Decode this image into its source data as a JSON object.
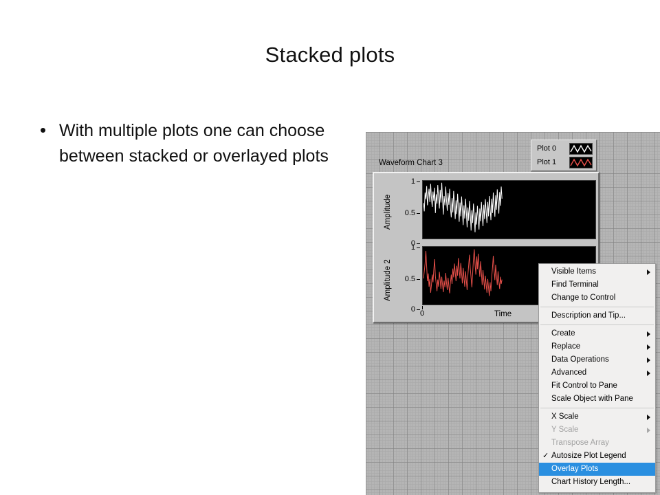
{
  "slide": {
    "title": "Stacked plots",
    "bullet_marker": "•",
    "bullet_text": "With multiple plots one can choose between stacked or overlayed plots"
  },
  "labview": {
    "chart_title": "Waveform Chart 3",
    "legend": {
      "rows": [
        {
          "label": "Plot 0",
          "color": "#ffffff",
          "icon": "waveform-icon"
        },
        {
          "label": "Plot 1",
          "color": "#e8504a",
          "icon": "waveform-icon"
        }
      ]
    },
    "axes": {
      "x_label": "Time",
      "x_tick_zero": "0",
      "top_y_label": "Amplitude",
      "bottom_y_label": "Amplitude 2",
      "y_ticks": [
        "1",
        "0.5",
        "0"
      ]
    },
    "colors": {
      "panel_grid": "#b5b5b5",
      "plot_background": "#000000",
      "plot0": "#ffffff",
      "plot1": "#e8504a",
      "menu_highlight": "#2a8fe0"
    }
  },
  "context_menu": {
    "items": [
      {
        "label": "Visible Items",
        "submenu": true,
        "disabled": false,
        "checked": false,
        "selected": false,
        "sep_after": false
      },
      {
        "label": "Find Terminal",
        "submenu": false,
        "disabled": false,
        "checked": false,
        "selected": false,
        "sep_after": false
      },
      {
        "label": "Change to Control",
        "submenu": false,
        "disabled": false,
        "checked": false,
        "selected": false,
        "sep_after": true
      },
      {
        "label": "Description and Tip...",
        "submenu": false,
        "disabled": false,
        "checked": false,
        "selected": false,
        "sep_after": true
      },
      {
        "label": "Create",
        "submenu": true,
        "disabled": false,
        "checked": false,
        "selected": false,
        "sep_after": false
      },
      {
        "label": "Replace",
        "submenu": true,
        "disabled": false,
        "checked": false,
        "selected": false,
        "sep_after": false
      },
      {
        "label": "Data Operations",
        "submenu": true,
        "disabled": false,
        "checked": false,
        "selected": false,
        "sep_after": false
      },
      {
        "label": "Advanced",
        "submenu": true,
        "disabled": false,
        "checked": false,
        "selected": false,
        "sep_after": false
      },
      {
        "label": "Fit Control to Pane",
        "submenu": false,
        "disabled": false,
        "checked": false,
        "selected": false,
        "sep_after": false
      },
      {
        "label": "Scale Object with Pane",
        "submenu": false,
        "disabled": false,
        "checked": false,
        "selected": false,
        "sep_after": true
      },
      {
        "label": "X Scale",
        "submenu": true,
        "disabled": false,
        "checked": false,
        "selected": false,
        "sep_after": false
      },
      {
        "label": "Y Scale",
        "submenu": true,
        "disabled": true,
        "checked": false,
        "selected": false,
        "sep_after": false
      },
      {
        "label": "Transpose Array",
        "submenu": false,
        "disabled": true,
        "checked": false,
        "selected": false,
        "sep_after": false
      },
      {
        "label": "Autosize Plot Legend",
        "submenu": false,
        "disabled": false,
        "checked": true,
        "selected": false,
        "sep_after": false
      },
      {
        "label": "Overlay Plots",
        "submenu": false,
        "disabled": false,
        "checked": false,
        "selected": true,
        "sep_after": false
      },
      {
        "label": "Chart History Length...",
        "submenu": false,
        "disabled": false,
        "checked": false,
        "selected": false,
        "sep_after": false
      }
    ],
    "checkmark_glyph": "✓"
  },
  "chart_data": {
    "type": "line",
    "title": "Waveform Chart 3",
    "xlabel": "Time",
    "layout": "stacked",
    "grid": false,
    "legend_position": "top-right",
    "panels": [
      {
        "name": "Plot 0",
        "ylabel": "Amplitude",
        "ylim": [
          0,
          1
        ],
        "yticks": [
          0,
          0.5,
          1
        ],
        "color": "#ffffff",
        "values": [
          0.62,
          0.47,
          0.81,
          0.69,
          0.93,
          0.58,
          0.74,
          0.88,
          0.64,
          0.97,
          0.71,
          0.55,
          0.83,
          0.66,
          0.9,
          0.44,
          0.78,
          0.61,
          0.95,
          0.72,
          0.52,
          0.86,
          0.63,
          0.99,
          0.7,
          0.41,
          0.75,
          0.58,
          0.92,
          0.67,
          0.48,
          0.8,
          0.59,
          0.88,
          0.53,
          0.36,
          0.71,
          0.45,
          0.84,
          0.6,
          0.33,
          0.67,
          0.42,
          0.79,
          0.55,
          0.28,
          0.63,
          0.38,
          0.74,
          0.5,
          0.22,
          0.58,
          0.34,
          0.7,
          0.46,
          0.18,
          0.54,
          0.3,
          0.66,
          0.43,
          0.12,
          0.49,
          0.26,
          0.61,
          0.39,
          0.09,
          0.45,
          0.23,
          0.57,
          0.35,
          0.14,
          0.52,
          0.29,
          0.64,
          0.41,
          0.2,
          0.59,
          0.33,
          0.69,
          0.47,
          0.26,
          0.64,
          0.38,
          0.75,
          0.52,
          0.31,
          0.7,
          0.44,
          0.81,
          0.58,
          0.37,
          0.76,
          0.5,
          0.87,
          0.64,
          0.43,
          0.82,
          0.57,
          0.92,
          0.7
        ]
      },
      {
        "name": "Plot 1",
        "ylabel": "Amplitude 2",
        "ylim": [
          0,
          1
        ],
        "yticks": [
          0,
          0.5,
          1
        ],
        "color": "#e8504a",
        "values": [
          0.45,
          0.58,
          0.72,
          0.95,
          0.66,
          0.4,
          0.54,
          0.3,
          0.44,
          0.19,
          0.33,
          0.52,
          0.38,
          0.61,
          0.8,
          0.49,
          0.35,
          0.22,
          0.43,
          0.3,
          0.57,
          0.42,
          0.26,
          0.48,
          0.33,
          0.2,
          0.41,
          0.29,
          0.55,
          0.37,
          0.24,
          0.46,
          0.31,
          0.18,
          0.38,
          0.52,
          0.35,
          0.63,
          0.47,
          0.72,
          0.56,
          0.4,
          0.68,
          0.5,
          0.82,
          0.61,
          0.45,
          0.73,
          0.54,
          0.36,
          0.64,
          0.47,
          0.3,
          0.58,
          0.41,
          0.24,
          0.52,
          0.7,
          0.88,
          0.63,
          0.46,
          0.29,
          0.55,
          0.8,
          0.98,
          0.71,
          0.52,
          0.85,
          0.62,
          0.9,
          0.67,
          0.48,
          0.76,
          0.55,
          0.33,
          0.6,
          0.42,
          0.25,
          0.5,
          0.34,
          0.19,
          0.44,
          0.28,
          0.13,
          0.38,
          0.22,
          0.47,
          0.65,
          0.86,
          0.6,
          0.42,
          0.7,
          0.51,
          0.33,
          0.58,
          0.4,
          0.26,
          0.48,
          0.35,
          0.43
        ]
      }
    ]
  }
}
